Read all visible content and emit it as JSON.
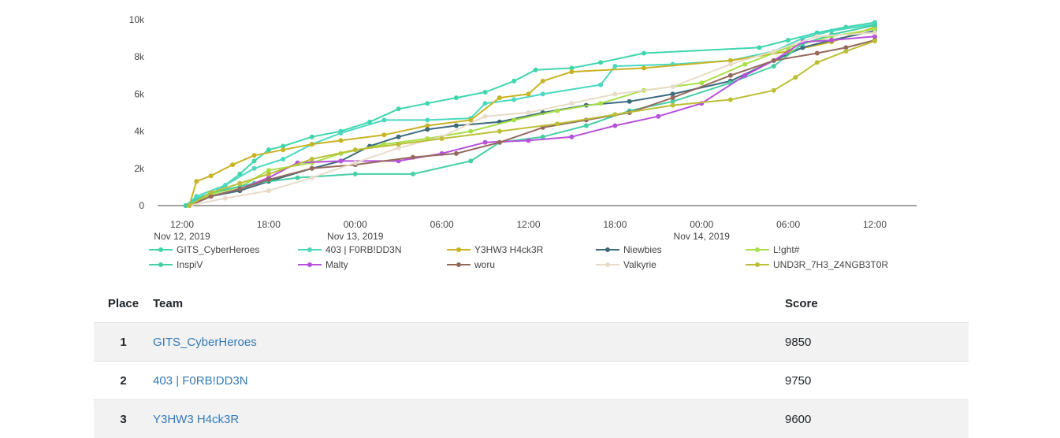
{
  "chart_data": {
    "type": "line",
    "title": "",
    "xlabel": "",
    "ylabel": "",
    "x_range": [
      "2019-11-12T12:00",
      "2019-11-14T12:00"
    ],
    "ylim": [
      0,
      10000
    ],
    "y_ticks": [
      0,
      2000,
      4000,
      6000,
      8000,
      10000
    ],
    "y_tick_labels": [
      "0",
      "2k",
      "4k",
      "6k",
      "8k",
      "10k"
    ],
    "x_ticks": [
      {
        "t": "2019-11-12T12:00",
        "label": "12:00",
        "sub": "Nov 12, 2019"
      },
      {
        "t": "2019-11-12T18:00",
        "label": "18:00",
        "sub": ""
      },
      {
        "t": "2019-11-13T00:00",
        "label": "00:00",
        "sub": "Nov 13, 2019"
      },
      {
        "t": "2019-11-13T06:00",
        "label": "06:00",
        "sub": ""
      },
      {
        "t": "2019-11-13T12:00",
        "label": "12:00",
        "sub": ""
      },
      {
        "t": "2019-11-13T18:00",
        "label": "18:00",
        "sub": ""
      },
      {
        "t": "2019-11-14T00:00",
        "label": "00:00",
        "sub": "Nov 14, 2019"
      },
      {
        "t": "2019-11-14T06:00",
        "label": "06:00",
        "sub": ""
      },
      {
        "t": "2019-11-14T12:00",
        "label": "12:00",
        "sub": ""
      }
    ],
    "grid": false,
    "legend_position": "bottom",
    "series": [
      {
        "name": "GITS_CyberHeroes",
        "color": "#3fd6ad",
        "points": [
          [
            "2019-11-12T12:15",
            0
          ],
          [
            "2019-11-12T13:00",
            400
          ],
          [
            "2019-11-12T14:30",
            800
          ],
          [
            "2019-11-12T16:00",
            1700
          ],
          [
            "2019-11-12T17:00",
            2400
          ],
          [
            "2019-11-12T18:00",
            3000
          ],
          [
            "2019-11-12T19:00",
            3200
          ],
          [
            "2019-11-12T21:00",
            3700
          ],
          [
            "2019-11-12T23:00",
            4000
          ],
          [
            "2019-11-13T01:00",
            4500
          ],
          [
            "2019-11-13T03:00",
            5200
          ],
          [
            "2019-11-13T05:00",
            5500
          ],
          [
            "2019-11-13T07:00",
            5800
          ],
          [
            "2019-11-13T09:00",
            6100
          ],
          [
            "2019-11-13T11:00",
            6700
          ],
          [
            "2019-11-13T12:30",
            7300
          ],
          [
            "2019-11-13T15:00",
            7400
          ],
          [
            "2019-11-13T17:00",
            7700
          ],
          [
            "2019-11-13T20:00",
            8200
          ],
          [
            "2019-11-14T04:00",
            8500
          ],
          [
            "2019-11-14T06:00",
            8900
          ],
          [
            "2019-11-14T08:00",
            9300
          ],
          [
            "2019-11-14T10:00",
            9600
          ],
          [
            "2019-11-14T12:00",
            9850
          ]
        ]
      },
      {
        "name": "403 | F0RB!DD3N",
        "color": "#4ad8c0",
        "points": [
          [
            "2019-11-12T12:15",
            0
          ],
          [
            "2019-11-12T13:00",
            500
          ],
          [
            "2019-11-12T15:00",
            1100
          ],
          [
            "2019-11-12T17:00",
            2000
          ],
          [
            "2019-11-12T19:00",
            2500
          ],
          [
            "2019-11-12T21:00",
            3300
          ],
          [
            "2019-11-12T23:00",
            3900
          ],
          [
            "2019-11-13T02:00",
            4600
          ],
          [
            "2019-11-13T05:00",
            4600
          ],
          [
            "2019-11-13T08:00",
            4700
          ],
          [
            "2019-11-13T09:00",
            5500
          ],
          [
            "2019-11-13T11:00",
            5700
          ],
          [
            "2019-11-13T13:00",
            6000
          ],
          [
            "2019-11-13T17:00",
            6500
          ],
          [
            "2019-11-13T18:00",
            7500
          ],
          [
            "2019-11-13T22:00",
            7600
          ],
          [
            "2019-11-14T02:00",
            7800
          ],
          [
            "2019-11-14T05:00",
            8300
          ],
          [
            "2019-11-14T07:00",
            9000
          ],
          [
            "2019-11-14T09:00",
            9400
          ],
          [
            "2019-11-14T12:00",
            9750
          ]
        ]
      },
      {
        "name": "Y3HW3 H4ck3R",
        "color": "#c8b323",
        "points": [
          [
            "2019-11-12T12:30",
            0
          ],
          [
            "2019-11-12T13:00",
            1300
          ],
          [
            "2019-11-12T14:00",
            1600
          ],
          [
            "2019-11-12T15:30",
            2200
          ],
          [
            "2019-11-12T17:00",
            2700
          ],
          [
            "2019-11-12T19:00",
            3000
          ],
          [
            "2019-11-12T21:00",
            3300
          ],
          [
            "2019-11-12T23:00",
            3500
          ],
          [
            "2019-11-13T02:00",
            3800
          ],
          [
            "2019-11-13T05:00",
            4300
          ],
          [
            "2019-11-13T08:00",
            4600
          ],
          [
            "2019-11-13T10:00",
            5800
          ],
          [
            "2019-11-13T12:00",
            6000
          ],
          [
            "2019-11-13T13:00",
            6700
          ],
          [
            "2019-11-13T15:00",
            7200
          ],
          [
            "2019-11-13T20:00",
            7400
          ],
          [
            "2019-11-14T02:00",
            7800
          ],
          [
            "2019-11-14T06:00",
            8300
          ],
          [
            "2019-11-14T09:00",
            8800
          ],
          [
            "2019-11-14T12:00",
            9600
          ]
        ]
      },
      {
        "name": "Niewbies",
        "color": "#3d6a7d",
        "points": [
          [
            "2019-11-12T12:30",
            0
          ],
          [
            "2019-11-12T14:00",
            500
          ],
          [
            "2019-11-12T16:00",
            800
          ],
          [
            "2019-11-12T18:00",
            1300
          ],
          [
            "2019-11-12T21:00",
            2000
          ],
          [
            "2019-11-12T23:00",
            2400
          ],
          [
            "2019-11-13T01:00",
            3200
          ],
          [
            "2019-11-13T03:00",
            3700
          ],
          [
            "2019-11-13T05:00",
            4100
          ],
          [
            "2019-11-13T07:00",
            4300
          ],
          [
            "2019-11-13T10:00",
            4500
          ],
          [
            "2019-11-13T13:00",
            5000
          ],
          [
            "2019-11-13T16:00",
            5400
          ],
          [
            "2019-11-13T19:00",
            5600
          ],
          [
            "2019-11-13T22:00",
            6000
          ],
          [
            "2019-11-14T02:00",
            6700
          ],
          [
            "2019-11-14T05:00",
            7800
          ],
          [
            "2019-11-14T07:00",
            8500
          ],
          [
            "2019-11-14T09:00",
            8900
          ],
          [
            "2019-11-14T12:00",
            9400
          ]
        ]
      },
      {
        "name": "L!ght#",
        "color": "#a8e04a",
        "points": [
          [
            "2019-11-12T12:30",
            0
          ],
          [
            "2019-11-12T14:00",
            600
          ],
          [
            "2019-11-12T16:00",
            1000
          ],
          [
            "2019-11-12T18:00",
            1900
          ],
          [
            "2019-11-12T21:00",
            2300
          ],
          [
            "2019-11-12T23:00",
            2800
          ],
          [
            "2019-11-13T02:00",
            3300
          ],
          [
            "2019-11-13T05:00",
            3600
          ],
          [
            "2019-11-13T08:00",
            4000
          ],
          [
            "2019-11-13T11:00",
            4600
          ],
          [
            "2019-11-13T14:00",
            5100
          ],
          [
            "2019-11-13T17:00",
            5500
          ],
          [
            "2019-11-13T20:00",
            6200
          ],
          [
            "2019-11-14T00:00",
            6600
          ],
          [
            "2019-11-14T03:00",
            7600
          ],
          [
            "2019-11-14T06:00",
            8500
          ],
          [
            "2019-11-14T09:00",
            9100
          ],
          [
            "2019-11-14T12:00",
            9500
          ]
        ]
      },
      {
        "name": "InspiV",
        "color": "#46cfa6",
        "points": [
          [
            "2019-11-12T12:15",
            0
          ],
          [
            "2019-11-12T14:00",
            700
          ],
          [
            "2019-11-12T17:00",
            1200
          ],
          [
            "2019-11-12T20:00",
            1500
          ],
          [
            "2019-11-13T00:00",
            1700
          ],
          [
            "2019-11-13T04:00",
            1700
          ],
          [
            "2019-11-13T08:00",
            2400
          ],
          [
            "2019-11-13T10:00",
            3400
          ],
          [
            "2019-11-13T13:00",
            3700
          ],
          [
            "2019-11-13T16:00",
            4300
          ],
          [
            "2019-11-13T19:00",
            5100
          ],
          [
            "2019-11-13T22:00",
            5600
          ],
          [
            "2019-11-14T02:00",
            6600
          ],
          [
            "2019-11-14T05:00",
            7500
          ],
          [
            "2019-11-14T07:00",
            8700
          ],
          [
            "2019-11-14T09:00",
            9200
          ],
          [
            "2019-11-14T12:00",
            9700
          ]
        ]
      },
      {
        "name": "Malty",
        "color": "#b751db",
        "points": [
          [
            "2019-11-12T12:30",
            0
          ],
          [
            "2019-11-12T14:00",
            500
          ],
          [
            "2019-11-12T16:00",
            900
          ],
          [
            "2019-11-12T18:00",
            1500
          ],
          [
            "2019-11-12T20:00",
            2300
          ],
          [
            "2019-11-12T23:00",
            2400
          ],
          [
            "2019-11-13T03:00",
            2400
          ],
          [
            "2019-11-13T06:00",
            2800
          ],
          [
            "2019-11-13T09:00",
            3400
          ],
          [
            "2019-11-13T12:00",
            3500
          ],
          [
            "2019-11-13T15:00",
            3700
          ],
          [
            "2019-11-13T18:00",
            4300
          ],
          [
            "2019-11-13T21:00",
            4800
          ],
          [
            "2019-11-14T00:00",
            5500
          ],
          [
            "2019-11-14T03:00",
            7000
          ],
          [
            "2019-11-14T05:00",
            7800
          ],
          [
            "2019-11-14T07:00",
            8800
          ],
          [
            "2019-11-14T09:00",
            8900
          ],
          [
            "2019-11-14T12:00",
            9100
          ]
        ]
      },
      {
        "name": "woru",
        "color": "#956a5d",
        "points": [
          [
            "2019-11-12T12:30",
            0
          ],
          [
            "2019-11-12T14:00",
            500
          ],
          [
            "2019-11-12T16:00",
            900
          ],
          [
            "2019-11-12T18:00",
            1400
          ],
          [
            "2019-11-12T21:00",
            2000
          ],
          [
            "2019-11-13T00:00",
            2200
          ],
          [
            "2019-11-13T04:00",
            2600
          ],
          [
            "2019-11-13T07:00",
            2800
          ],
          [
            "2019-11-13T10:00",
            3400
          ],
          [
            "2019-11-13T13:00",
            4200
          ],
          [
            "2019-11-13T16:00",
            4600
          ],
          [
            "2019-11-13T19:00",
            5000
          ],
          [
            "2019-11-13T22:00",
            5800
          ],
          [
            "2019-11-14T02:00",
            7000
          ],
          [
            "2019-11-14T05:00",
            7800
          ],
          [
            "2019-11-14T08:00",
            8200
          ],
          [
            "2019-11-14T10:00",
            8500
          ],
          [
            "2019-11-14T12:00",
            8900
          ]
        ]
      },
      {
        "name": "Valkyrie",
        "color": "#e8dbc8",
        "points": [
          [
            "2019-11-12T12:30",
            0
          ],
          [
            "2019-11-12T15:00",
            400
          ],
          [
            "2019-11-12T18:00",
            800
          ],
          [
            "2019-11-12T21:00",
            1500
          ],
          [
            "2019-11-13T00:00",
            2300
          ],
          [
            "2019-11-13T03:00",
            3100
          ],
          [
            "2019-11-13T06:00",
            3700
          ],
          [
            "2019-11-13T09:00",
            4800
          ],
          [
            "2019-11-13T12:00",
            5000
          ],
          [
            "2019-11-13T15:00",
            5500
          ],
          [
            "2019-11-13T18:00",
            6000
          ],
          [
            "2019-11-13T22:00",
            6400
          ],
          [
            "2019-11-14T02:00",
            7600
          ],
          [
            "2019-11-14T05:00",
            8300
          ],
          [
            "2019-11-14T08:00",
            9100
          ],
          [
            "2019-11-14T12:00",
            9300
          ]
        ]
      },
      {
        "name": "UND3R_7H3_Z4NGB3T0R",
        "color": "#bcbf36",
        "points": [
          [
            "2019-11-12T12:30",
            0
          ],
          [
            "2019-11-12T14:00",
            700
          ],
          [
            "2019-11-12T16:00",
            1200
          ],
          [
            "2019-11-12T18:00",
            1700
          ],
          [
            "2019-11-12T21:00",
            2500
          ],
          [
            "2019-11-13T00:00",
            3000
          ],
          [
            "2019-11-13T03:00",
            3300
          ],
          [
            "2019-11-13T06:00",
            3600
          ],
          [
            "2019-11-13T10:00",
            4000
          ],
          [
            "2019-11-13T14:00",
            4400
          ],
          [
            "2019-11-13T18:00",
            4900
          ],
          [
            "2019-11-13T22:00",
            5400
          ],
          [
            "2019-11-14T02:00",
            5700
          ],
          [
            "2019-11-14T05:00",
            6200
          ],
          [
            "2019-11-14T06:30",
            6900
          ],
          [
            "2019-11-14T08:00",
            7700
          ],
          [
            "2019-11-14T10:00",
            8300
          ],
          [
            "2019-11-14T12:00",
            8850
          ]
        ]
      }
    ]
  },
  "scoreboard": {
    "headers": {
      "place": "Place",
      "team": "Team",
      "score": "Score"
    },
    "rows": [
      {
        "place": "1",
        "team": "GITS_CyberHeroes",
        "score": "9850"
      },
      {
        "place": "2",
        "team": "403 | F0RB!DD3N",
        "score": "9750"
      },
      {
        "place": "3",
        "team": "Y3HW3 H4ck3R",
        "score": "9600"
      }
    ]
  }
}
